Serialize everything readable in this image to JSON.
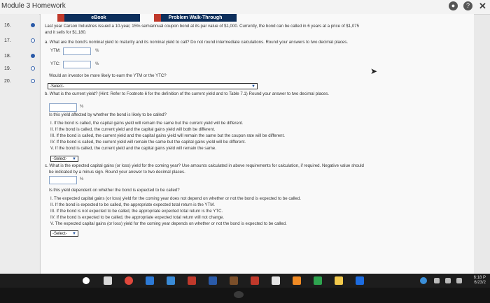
{
  "window": {
    "title": "Module 3 Homework"
  },
  "sidebar": {
    "items": [
      {
        "num": "16.",
        "state": "full"
      },
      {
        "num": "17.",
        "state": "ring"
      },
      {
        "num": "18.",
        "state": "full"
      },
      {
        "num": "19.",
        "state": "ring"
      },
      {
        "num": "20.",
        "state": "ring"
      }
    ]
  },
  "tabs": {
    "ebook": "eBook",
    "walkthrough": "Problem Walk-Through"
  },
  "problem": {
    "intro1": "Last year Carson Industries issued a 10-year, 15% semiannual coupon bond at its par value of $1,000. Currently, the bond can be called in 6 years at a price of $1,075",
    "intro2": "and it sells for $1,180.",
    "part_a": "a. What are the bond's nominal yield to maturity and its nominal yield to call? Do not round intermediate calculations. Round your answers to two decimal places.",
    "ytm_label": "YTM:",
    "ytc_label": "YTC:",
    "pct": "%",
    "investor_q": "Would an investor be more likely to earn the YTM or the YTC?",
    "select_placeholder": "-Select-",
    "part_b": "b. What is the current yield? (Hint: Refer to Footnote 6 for the definition of the current yield and to Table 7.1) Round your answer to two decimal places.",
    "affected_q": "Is this yield affected by whether the bond is likely to be called?",
    "b_options": [
      "I. If the bond is called, the capital gains yield will remain the same but the current yield will be different.",
      "II. If the bond is called, the current yield and the capital gains yield will both be different.",
      "III. If the bond is called, the current yield and the capital gains yield will remain the same but the coupon rate will be different.",
      "IV. If the bond is called, the current yield will remain the same but the capital gains yield will be different.",
      "V. If the bond is called, the current yield and the capital gains yield will remain the same."
    ],
    "part_c1": "c. What is the expected capital gains (or loss) yield for the coming year? Use amounts calculated in above requirements for calculation, if required. Negative value should",
    "part_c2": "be indicated by a minus sign. Round your answer to two decimal places.",
    "dependent_q": "Is this yield dependent on whether the bond is expected to be called?",
    "c_options": [
      "I. The expected capital gains (or loss) yield for the coming year does not depend on whether or not the bond is expected to be called.",
      "II. If the bond is expected to be called, the appropriate expected total return is the YTM.",
      "III. If the bond is not expected to be called, the appropriate expected total return is the YTC.",
      "IV. If the bond is expected to be called, the appropriate expected total return will not change.",
      "V. The expected capital gains (or loss) yield for the coming year depends on whether or not the bond is expected to be called."
    ],
    "select_short": "-Select-"
  },
  "taskbar": {
    "time": "6:18 P",
    "date": "6/23/2"
  },
  "colors": {
    "tab": "#0d2f5c",
    "accent": "#2a5aa8"
  }
}
